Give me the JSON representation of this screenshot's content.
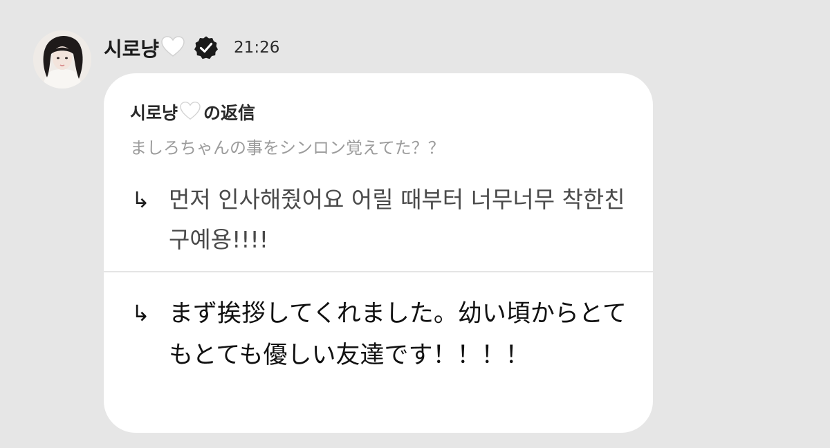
{
  "post": {
    "sender_name": "시로냥",
    "heart_icon": "white-heart-icon",
    "verified_icon": "verified-badge-icon",
    "timestamp": "21:26"
  },
  "reply": {
    "name": "시로냥",
    "suffix": "の返信",
    "quoted_text": "ましろちゃんの事をシンロン覚えてた？？",
    "answers": [
      {
        "arrow": "↳",
        "text": "먼저 인사해줬어요 어릴 때부터 너무너무 착한친구예용!!!!"
      },
      {
        "arrow": "↳",
        "text": "まず挨拶してくれました。幼い頃からとてもとても優しい友達です！！！！"
      }
    ]
  },
  "colors": {
    "background": "#e6e6e6",
    "bubble": "#ffffff",
    "quoted_text": "#9c9c9c",
    "korean_text": "#4a4a4a",
    "japanese_text": "#111111"
  }
}
